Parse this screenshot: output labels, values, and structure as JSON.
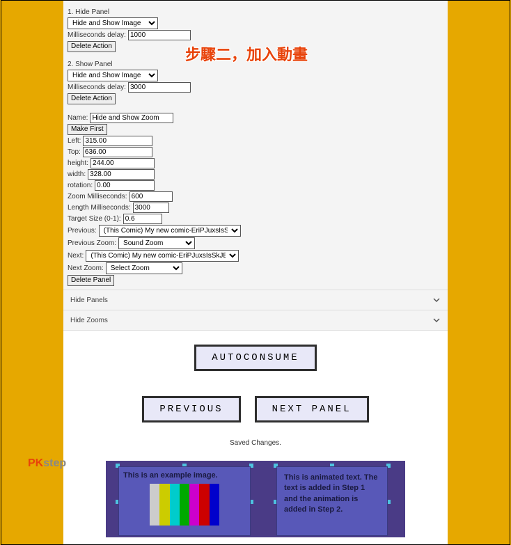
{
  "overlay_text": "步驟二，加入動畫",
  "section1": {
    "title": "1. Hide Panel",
    "action_select": "Hide and Show Image",
    "ms_label": "Milliseconds delay:",
    "ms_value": "1000",
    "del_label": "Delete Action"
  },
  "section2": {
    "title": "2. Show Panel",
    "action_select": "Hide and Show Image",
    "ms_label": "Milliseconds delay:",
    "ms_value": "3000",
    "del_label": "Delete Action"
  },
  "props": {
    "name_label": "Name:",
    "name_value": "Hide and Show Zoom",
    "make_first": "Make First",
    "left_label": "Left:",
    "left_value": "315.00",
    "top_label": "Top:",
    "top_value": "636.00",
    "height_label": "height:",
    "height_value": "244.00",
    "width_label": "width:",
    "width_value": "328.00",
    "rotation_label": "rotation:",
    "rotation_value": "0.00",
    "zoom_ms_label": "Zoom Milliseconds:",
    "zoom_ms_value": "600",
    "length_ms_label": "Length Milliseconds:",
    "length_ms_value": "3000",
    "target_label": "Target Size (0-1):",
    "target_value": "0.6",
    "prev_label": "Previous:",
    "prev_value": "(This Comic) My new comic-EriPJuxsIsSkJBvI",
    "prev_zoom_label": "Previous Zoom:",
    "prev_zoom_value": "Sound Zoom",
    "next_label": "Next:",
    "next_value": "(This Comic) My new comic-EriPJuxsIsSkJBvI",
    "next_zoom_label": "Next Zoom:",
    "next_zoom_value": "Select Zoom",
    "del_panel": "Delete Panel"
  },
  "accordion": {
    "hide_panels": "Hide Panels",
    "hide_zooms": "Hide Zooms"
  },
  "controls": {
    "autoconsume": "AUTOCONSUME",
    "previous": "PREVIOUS",
    "next_panel": "NEXT PANEL",
    "saved": "Saved Changes."
  },
  "preview": {
    "panel1_text": "This is an example image.",
    "panel2_text": "This is animated text. The text is added in Step 1 and the animation is added in Step 2."
  },
  "pk": {
    "p": "PK",
    "k": "step"
  }
}
